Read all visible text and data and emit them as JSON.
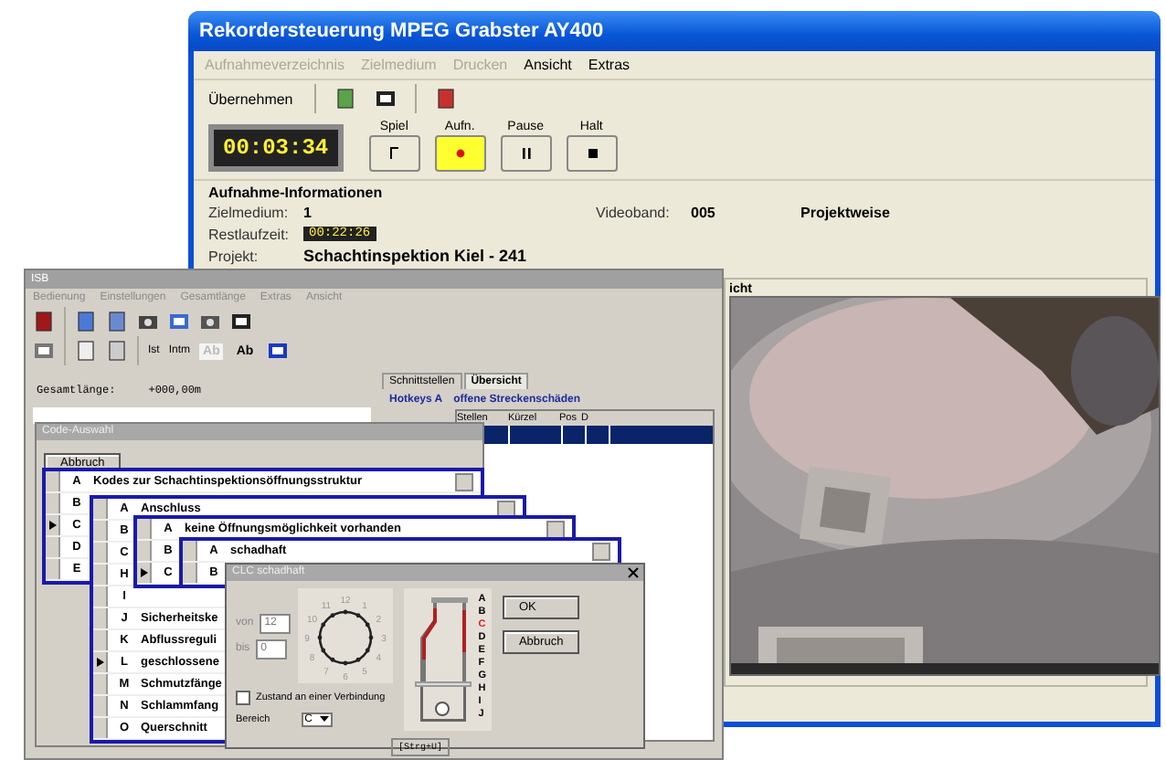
{
  "recorder": {
    "title": "Rekordersteuerung MPEG  Grabster AY400",
    "menu": [
      {
        "label": "Aufnahmeverzeichnis",
        "disabled": true
      },
      {
        "label": "Zielmedium",
        "disabled": true
      },
      {
        "label": "Drucken",
        "disabled": true
      },
      {
        "label": "Ansicht",
        "disabled": false
      },
      {
        "label": "Extras",
        "disabled": false
      }
    ],
    "toolbar_button": "Übernehmen",
    "time": "00:03:34",
    "transport": [
      {
        "label": "Spiel",
        "kind": "play",
        "selected": false
      },
      {
        "label": "Aufn.",
        "kind": "record",
        "selected": true
      },
      {
        "label": "Pause",
        "kind": "pause",
        "selected": false
      },
      {
        "label": "Halt",
        "kind": "stop",
        "selected": false
      }
    ],
    "info": {
      "title": "Aufnahme-Informationen",
      "rows": [
        [
          {
            "label": "Zielmedium:",
            "value": "1"
          },
          {
            "label": "Videoband:",
            "value": "005"
          },
          {
            "value": "Projektweise"
          }
        ],
        [
          {
            "label": "Restlaufzeit:",
            "value": "00:22:26",
            "kind": "timer"
          }
        ],
        [
          {
            "label": "Projekt:",
            "value": "Schachtinspektion Kiel - 241"
          }
        ]
      ]
    },
    "view": {
      "label": "icht"
    }
  },
  "inspection": {
    "title": "ISB",
    "menu": [
      "Bedienung",
      "Einstellungen",
      "Gesamtlänge",
      "Extras",
      "Ansicht"
    ],
    "toolbar_texts": [
      "Ist",
      "Intm"
    ],
    "style_buttons": [
      {
        "label": "Ab",
        "selected": true
      },
      {
        "label": "Ab",
        "selected": false
      }
    ],
    "total_length": {
      "label": "Gesamtlänge:",
      "value": "+000,00m"
    },
    "tabs": [
      {
        "label": "Schnittstellen",
        "selected": false
      },
      {
        "label": "Übersicht",
        "selected": true
      }
    ],
    "groups": [
      "Hotkeys A",
      "offene Streckenschäden"
    ],
    "table": {
      "columns": [
        "Stellen",
        "Kürzel",
        "Pos",
        "D"
      ],
      "rows": [
        {
          "selected": true
        }
      ]
    },
    "status": "[Strg+U]",
    "code_dialog": {
      "title": "Code-Auswahl",
      "cancel": "Abbruch",
      "lists": [
        {
          "rows": [
            {
              "letter": "A",
              "text": "Kodes zur Schachtinspektionsöffnungsstruktur",
              "selected": false
            },
            {
              "letter": "B",
              "selected": false
            },
            {
              "letter": "C",
              "selected": true
            },
            {
              "letter": "D",
              "selected": false
            },
            {
              "letter": "E",
              "selected": false
            }
          ]
        },
        {
          "rows": [
            {
              "letter": "A",
              "text": "Anschluss",
              "selected": false
            },
            {
              "letter": "B",
              "selected": false
            },
            {
              "letter": "C",
              "selected": false
            },
            {
              "letter": "H",
              "selected": false
            },
            {
              "letter": "I",
              "selected": false
            },
            {
              "letter": "J",
              "text": "Sicherheitske",
              "selected": false
            },
            {
              "letter": "K",
              "text": "Abflussreguli",
              "selected": false
            },
            {
              "letter": "L",
              "text": "geschlossene",
              "selected": true
            },
            {
              "letter": "M",
              "text": "Schmutzfänge",
              "selected": false
            },
            {
              "letter": "N",
              "text": "Schlammfang",
              "selected": false
            },
            {
              "letter": "O",
              "text": "Querschnitt",
              "selected": false
            }
          ]
        },
        {
          "rows": [
            {
              "letter": "A",
              "text": "keine Öffnungsmöglichkeit vorhanden",
              "selected": false
            },
            {
              "letter": "B",
              "selected": false
            },
            {
              "letter": "C",
              "selected": true
            }
          ]
        },
        {
          "rows": [
            {
              "letter": "A",
              "text": "schadhaft",
              "selected": false
            },
            {
              "letter": "B",
              "selected": false
            }
          ]
        }
      ]
    },
    "clc_dialog": {
      "title": "CLC schadhaft",
      "from_label": "von",
      "from": "12",
      "to_label": "bis",
      "to": "0",
      "clock": [
        "12",
        "1",
        "2",
        "3",
        "4",
        "5",
        "6",
        "7",
        "8",
        "9",
        "10",
        "11"
      ],
      "zone_letters": [
        {
          "letter": "A",
          "selected": false
        },
        {
          "letter": "B",
          "selected": false
        },
        {
          "letter": "C",
          "selected": true
        },
        {
          "letter": "D",
          "selected": false
        },
        {
          "letter": "E",
          "selected": false
        },
        {
          "letter": "F",
          "selected": false
        },
        {
          "letter": "G",
          "selected": false
        },
        {
          "letter": "H",
          "selected": false
        },
        {
          "letter": "I",
          "selected": false
        },
        {
          "letter": "J",
          "selected": false
        }
      ],
      "connection": {
        "label": "Zustand an einer Verbindung",
        "checked": false
      },
      "area_label": "Bereich",
      "area": "C",
      "ok": "OK",
      "cancel": "Abbruch"
    }
  }
}
